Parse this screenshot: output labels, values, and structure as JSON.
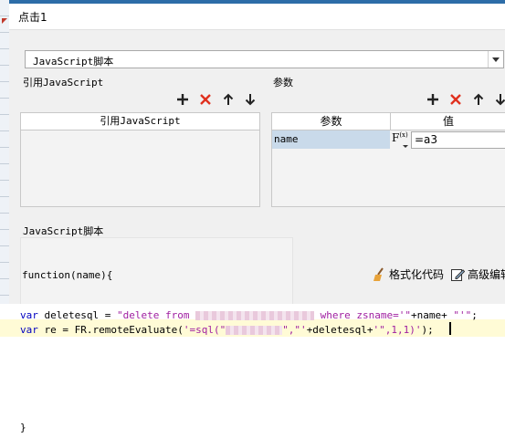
{
  "dialog": {
    "title": "点击1"
  },
  "script_type": {
    "selected": "JavaScript脚本"
  },
  "ref_section": {
    "label": "引用JavaScript",
    "column_header": "引用JavaScript"
  },
  "param_section": {
    "label": "参数",
    "column_headers": [
      "参数",
      "值"
    ],
    "rows": [
      {
        "name": "name",
        "fx_label": "F",
        "fx_sub": "(x)",
        "value": "=a3"
      }
    ]
  },
  "toolbar_icons": [
    "add-icon",
    "delete-icon",
    "move-up-icon",
    "move-down-icon"
  ],
  "script_section": {
    "label": "JavaScript脚本",
    "function_header": "function(name){",
    "format_button": "格式化代码",
    "advanced_button": "高级编辑",
    "code": {
      "line1_kw": "var",
      "line1_a": " deletesql = ",
      "line1_str1": "\"delete from ",
      "line1_str2": " where zsname='\"",
      "line1_mid": "+name+ ",
      "line1_str3": "\"'\"",
      "line1_end": ";",
      "line2_kw": "var",
      "line2_a": " re = FR.remoteEvaluate(",
      "line2_str1": "'=sql(\"",
      "line2_str2": "\",\"'",
      "line2_mid": "+deletesql+",
      "line2_str3": "'\",1,1)'",
      "line2_end": ");"
    },
    "closing": "}"
  },
  "colors": {
    "keyword": "#0000c0",
    "string": "#a020a0",
    "selection": "#c9daea",
    "delete": "#e0301e"
  }
}
